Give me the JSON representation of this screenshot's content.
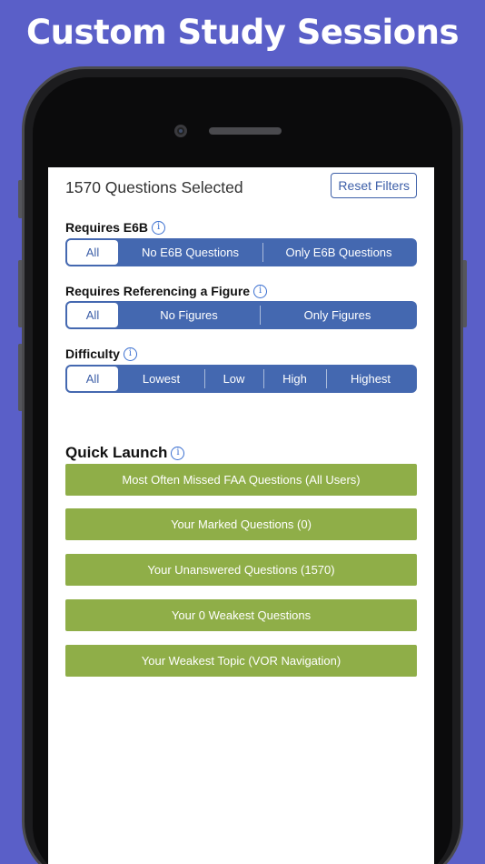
{
  "headline": "Custom Study Sessions",
  "header": {
    "selected_count": "1570 Questions Selected",
    "reset_label": "Reset Filters"
  },
  "filters": [
    {
      "label": "Requires E6B",
      "options": [
        "All",
        "No E6B Questions",
        "Only E6B Questions"
      ],
      "selected": "All"
    },
    {
      "label": "Requires Referencing a Figure",
      "options": [
        "All",
        "No Figures",
        "Only Figures"
      ],
      "selected": "All"
    },
    {
      "label": "Difficulty",
      "options": [
        "All",
        "Lowest",
        "Low",
        "High",
        "Highest"
      ],
      "selected": "All"
    }
  ],
  "quick_launch": {
    "title": "Quick Launch",
    "buttons": [
      "Most Often Missed FAA Questions (All Users)",
      "Your Marked Questions (0)",
      "Your Unanswered Questions (1570)",
      "Your 0 Weakest Questions",
      "Your Weakest Topic (VOR Navigation)"
    ]
  },
  "icons": {
    "info": "info-icon"
  },
  "colors": {
    "background": "#5a5fc8",
    "segment_blue": "#4468b0",
    "accent_blue": "#3d5fa8",
    "launch_green": "#8fae48"
  }
}
